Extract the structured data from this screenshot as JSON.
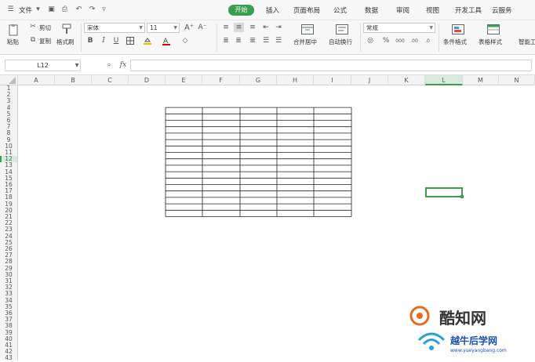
{
  "menubar": {
    "app_menu_label": "文件",
    "tabs": [
      {
        "label": "开始",
        "active": true
      },
      {
        "label": "插入"
      },
      {
        "label": "页面布局"
      },
      {
        "label": "公式"
      },
      {
        "label": "数据"
      },
      {
        "label": "审阅"
      },
      {
        "label": "视图"
      },
      {
        "label": "开发工具"
      },
      {
        "label": "云服务"
      }
    ]
  },
  "ribbon": {
    "paste_label": "粘贴",
    "cut_label": "剪切",
    "copy_label": "复制",
    "format_painter_label": "格式刷",
    "font_name": "宋体",
    "font_size": "11",
    "bold": "B",
    "italic": "I",
    "underline": "U",
    "merge_label": "合并居中",
    "wrap_label": "自动换行",
    "number_format": "常规",
    "conditional_format_label": "条件格式",
    "table_style_label": "表格样式",
    "smart_tools_label": "智能工"
  },
  "formula_bar": {
    "name_box": "L12",
    "fx": "fx"
  },
  "grid": {
    "columns": [
      "A",
      "B",
      "C",
      "D",
      "E",
      "F",
      "G",
      "H",
      "I",
      "J",
      "K",
      "L",
      "M",
      "N"
    ],
    "selected_column": "L",
    "rows": [
      "1",
      "2",
      "3",
      "4",
      "5",
      "6",
      "7",
      "8",
      "9",
      "10",
      "11",
      "12",
      "13",
      "14",
      "15",
      "16",
      "17",
      "18",
      "19",
      "20",
      "21",
      "22",
      "23",
      "24",
      "25",
      "26",
      "27",
      "28",
      "29",
      "30",
      "31",
      "32",
      "33",
      "34",
      "35",
      "36",
      "37",
      "38",
      "39",
      "40",
      "41",
      "42",
      "43"
    ],
    "selected_row": "12",
    "active_cell": "L12"
  },
  "watermark": {
    "line1": "酷知网",
    "line2": "越牛后学网",
    "url": "www.yueyangbang.com"
  },
  "colors": {
    "accent": "#3a9e4e",
    "selection": "#d9e9dc"
  }
}
